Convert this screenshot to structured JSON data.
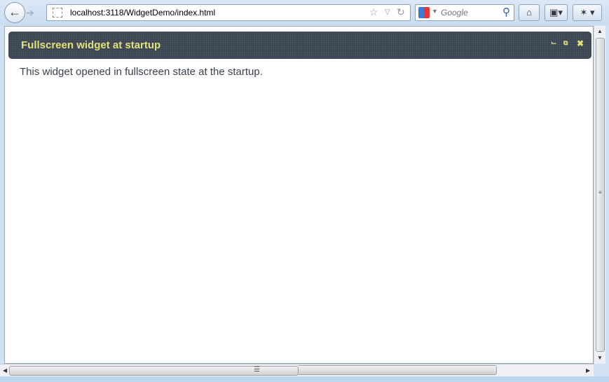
{
  "browser": {
    "url": "localhost:3118/WidgetDemo/index.html",
    "search_placeholder": "Google"
  },
  "widget": {
    "title": "Fullscreen widget at startup",
    "body": "This widget opened in fullscreen state at the startup.",
    "title_color": "#e2e27a",
    "header_color": "#3a4451"
  }
}
